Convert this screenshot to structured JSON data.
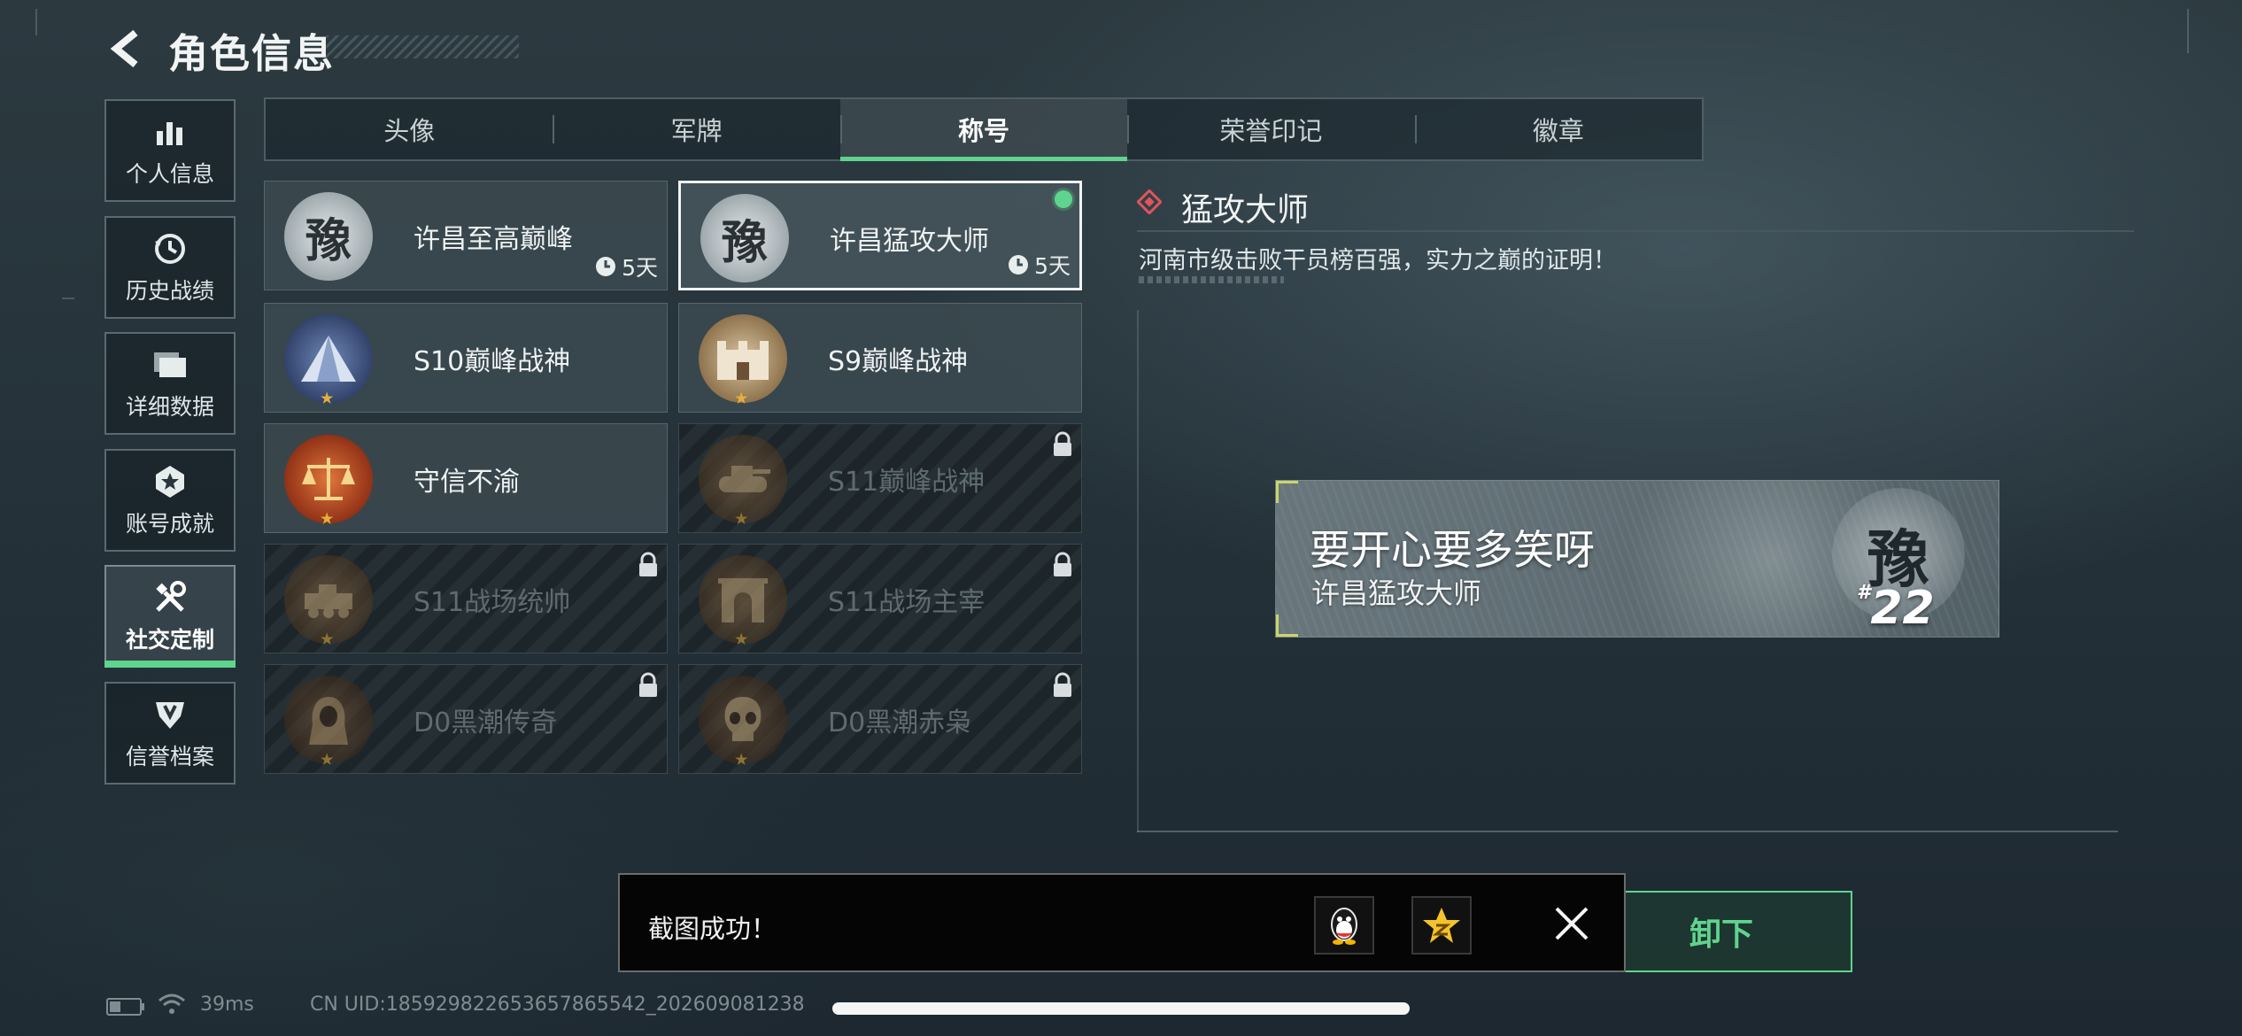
{
  "header": {
    "title": "角色信息"
  },
  "sidebar": {
    "items": [
      {
        "label": "个人信息",
        "icon": "bar-chart-icon"
      },
      {
        "label": "历史战绩",
        "icon": "history-clock-icon"
      },
      {
        "label": "详细数据",
        "icon": "folders-icon"
      },
      {
        "label": "账号成就",
        "icon": "achievement-star-icon"
      },
      {
        "label": "社交定制",
        "icon": "wrench-screwdriver-icon",
        "active": true
      },
      {
        "label": "信誉档案",
        "icon": "shield-icon"
      }
    ]
  },
  "tabs": [
    {
      "label": "头像"
    },
    {
      "label": "军牌"
    },
    {
      "label": "称号",
      "active": true
    },
    {
      "label": "荣誉印记"
    },
    {
      "label": "徽章"
    }
  ],
  "cards": [
    {
      "label": "许昌至高巅峰",
      "emblem_char": "豫",
      "timer": "5天",
      "locked": false,
      "selected": false
    },
    {
      "label": "许昌猛攻大师",
      "emblem_char": "豫",
      "timer": "5天",
      "locked": false,
      "selected": true
    },
    {
      "label": "S10巅峰战神",
      "emblem": "pyramid-emblem-icon",
      "locked": false
    },
    {
      "label": "S9巅峰战神",
      "emblem": "fortress-emblem-icon",
      "locked": false
    },
    {
      "label": "守信不渝",
      "emblem": "scales-emblem-icon",
      "locked": false
    },
    {
      "label": "S11巅峰战神",
      "emblem": "tank-emblem-icon",
      "locked": true
    },
    {
      "label": "S11战场统帅",
      "emblem": "vehicle-emblem-icon",
      "locked": true
    },
    {
      "label": "S11战场主宰",
      "emblem": "arch-emblem-icon",
      "locked": true
    },
    {
      "label": "D0黑潮传奇",
      "emblem": "hooded-figure-emblem-icon",
      "locked": true
    },
    {
      "label": "D0黑潮赤枭",
      "emblem": "skull-emblem-icon",
      "locked": true
    }
  ],
  "detail": {
    "title": "猛攻大师",
    "description": "河南市级击败干员榜百强，实力之巅的证明！"
  },
  "nameplate": {
    "motto": "要开心要多笑呀",
    "subtitle": "许昌猛攻大师",
    "emblem_char": "豫",
    "rank_prefix": "#",
    "rank": "22"
  },
  "confirm_button": {
    "label": "卸下",
    "visible_text": "卸下"
  },
  "toast": {
    "message": "截图成功！"
  },
  "status": {
    "ping": "39ms",
    "uid": "CN UID:1859298226536578655​42_202609081238"
  },
  "colors": {
    "accent_green": "#5fd48e",
    "selected_border": "#f0f3f3",
    "star_gold": "#e2b13c",
    "detail_diamond": "#e0545a"
  }
}
